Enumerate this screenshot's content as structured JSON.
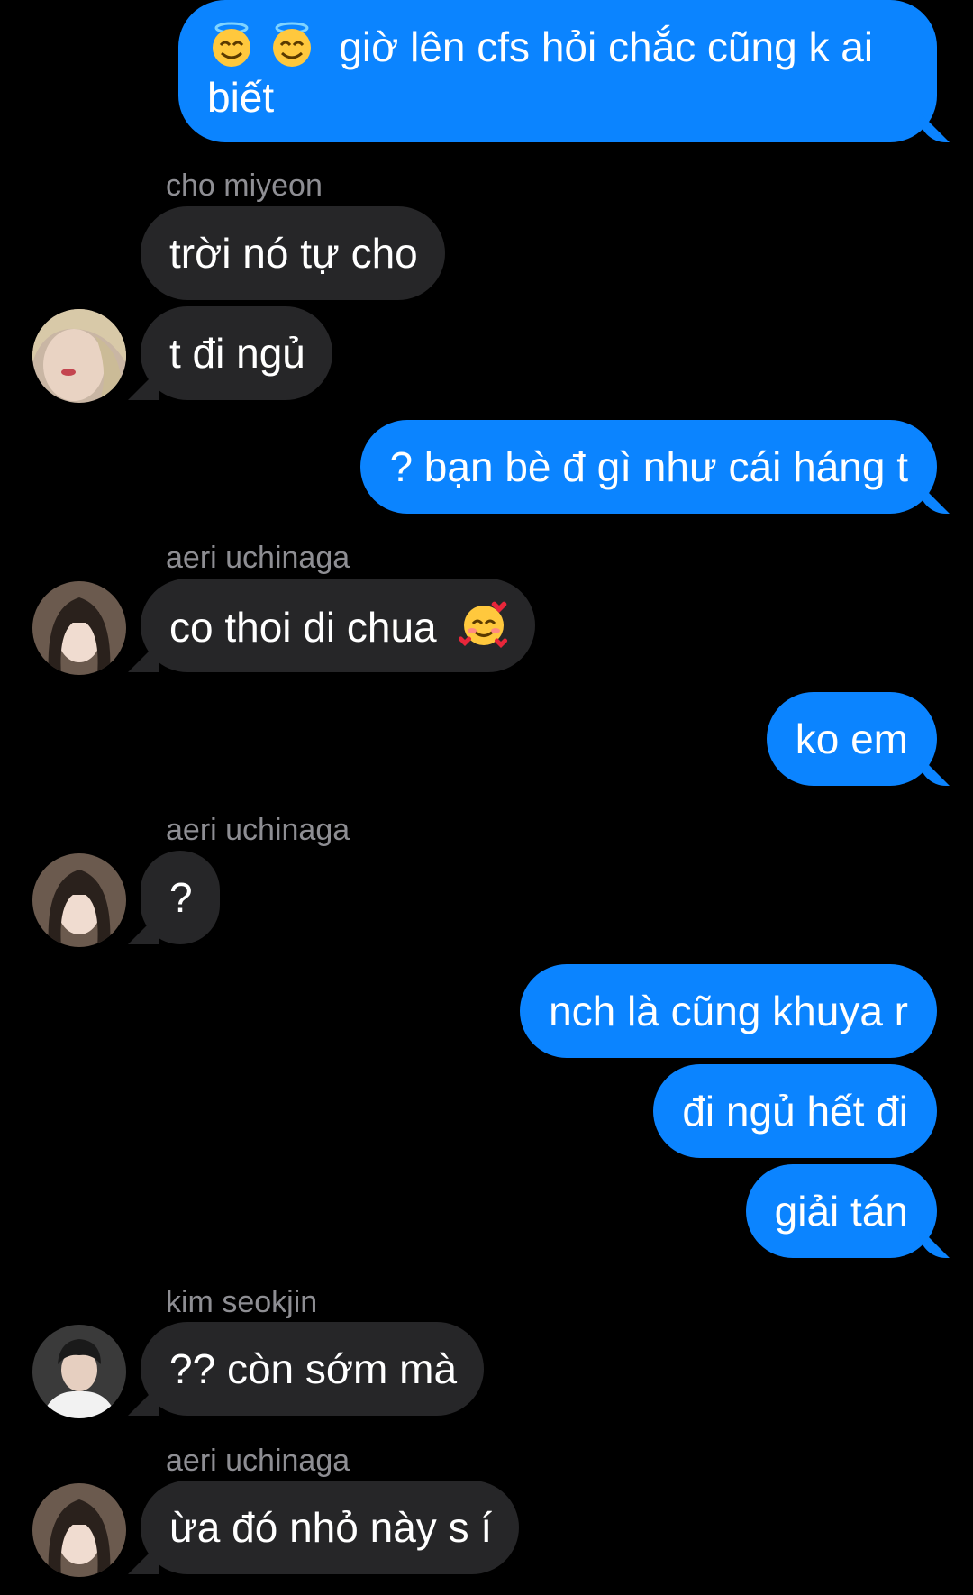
{
  "messages": {
    "m1": {
      "text_before": "",
      "text": " giờ lên cfs hỏi chắc cũng k ai",
      "line2": "biết",
      "emoji": [
        "smiling-face-with-halo",
        "smiling-face-with-halo"
      ]
    },
    "s1": "cho miyeon",
    "m2": "trời nó tự cho",
    "m3": "t đi ngủ",
    "m4": "? bạn bè đ gì như cái háng t",
    "s2": "aeri uchinaga",
    "m5": "co thoi di chua ",
    "m5_emoji": "smiling-face-with-hearts",
    "m6": "ko em",
    "s3": "aeri uchinaga",
    "m7": "?",
    "m8": "nch là cũng khuya r",
    "m9": "đi ngủ hết đi",
    "m10": "giải tán",
    "s4": "kim seokjin",
    "m11": "?? còn sớm mà",
    "s5": "aeri uchinaga",
    "m12": "ừa đó nhỏ này s í"
  },
  "colors": {
    "background": "#000000",
    "outgoing_bubble": "#0b84ff",
    "incoming_bubble": "#262628",
    "sender_name": "#8e8e93",
    "text": "#ffffff"
  }
}
